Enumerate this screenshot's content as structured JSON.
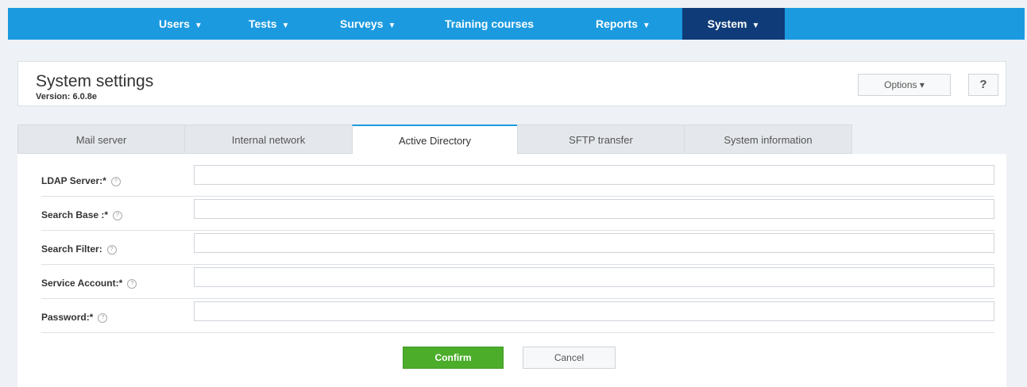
{
  "nav": {
    "items": [
      {
        "label": "Users",
        "caret": "▼"
      },
      {
        "label": "Tests",
        "caret": "▼"
      },
      {
        "label": "Surveys",
        "caret": "▼"
      },
      {
        "label": "Training courses",
        "caret": ""
      },
      {
        "label": "Reports",
        "caret": "▼"
      },
      {
        "label": "System",
        "caret": "▼"
      }
    ],
    "active": "System",
    "bar_color": "#1b9ae0",
    "active_color": "#0f3c78"
  },
  "header": {
    "title": "System settings",
    "version": "Version: 6.0.8e",
    "options_label": "Options ▾",
    "help_label": "?"
  },
  "tabs": [
    {
      "label": "Mail server"
    },
    {
      "label": "Internal network"
    },
    {
      "label": "Active Directory"
    },
    {
      "label": "SFTP transfer"
    },
    {
      "label": "System information"
    }
  ],
  "active_tab": "Active Directory",
  "form": {
    "fields": [
      {
        "label": "LDAP Server:*",
        "value": ""
      },
      {
        "label": "Search Base :*",
        "value": ""
      },
      {
        "label": "Search Filter:",
        "value": ""
      },
      {
        "label": "Service Account:*",
        "value": ""
      },
      {
        "label": "Password:*",
        "value": ""
      }
    ],
    "help_glyph": "?",
    "confirm_label": "Confirm",
    "cancel_label": "Cancel",
    "confirm_color": "#4cad2b"
  }
}
